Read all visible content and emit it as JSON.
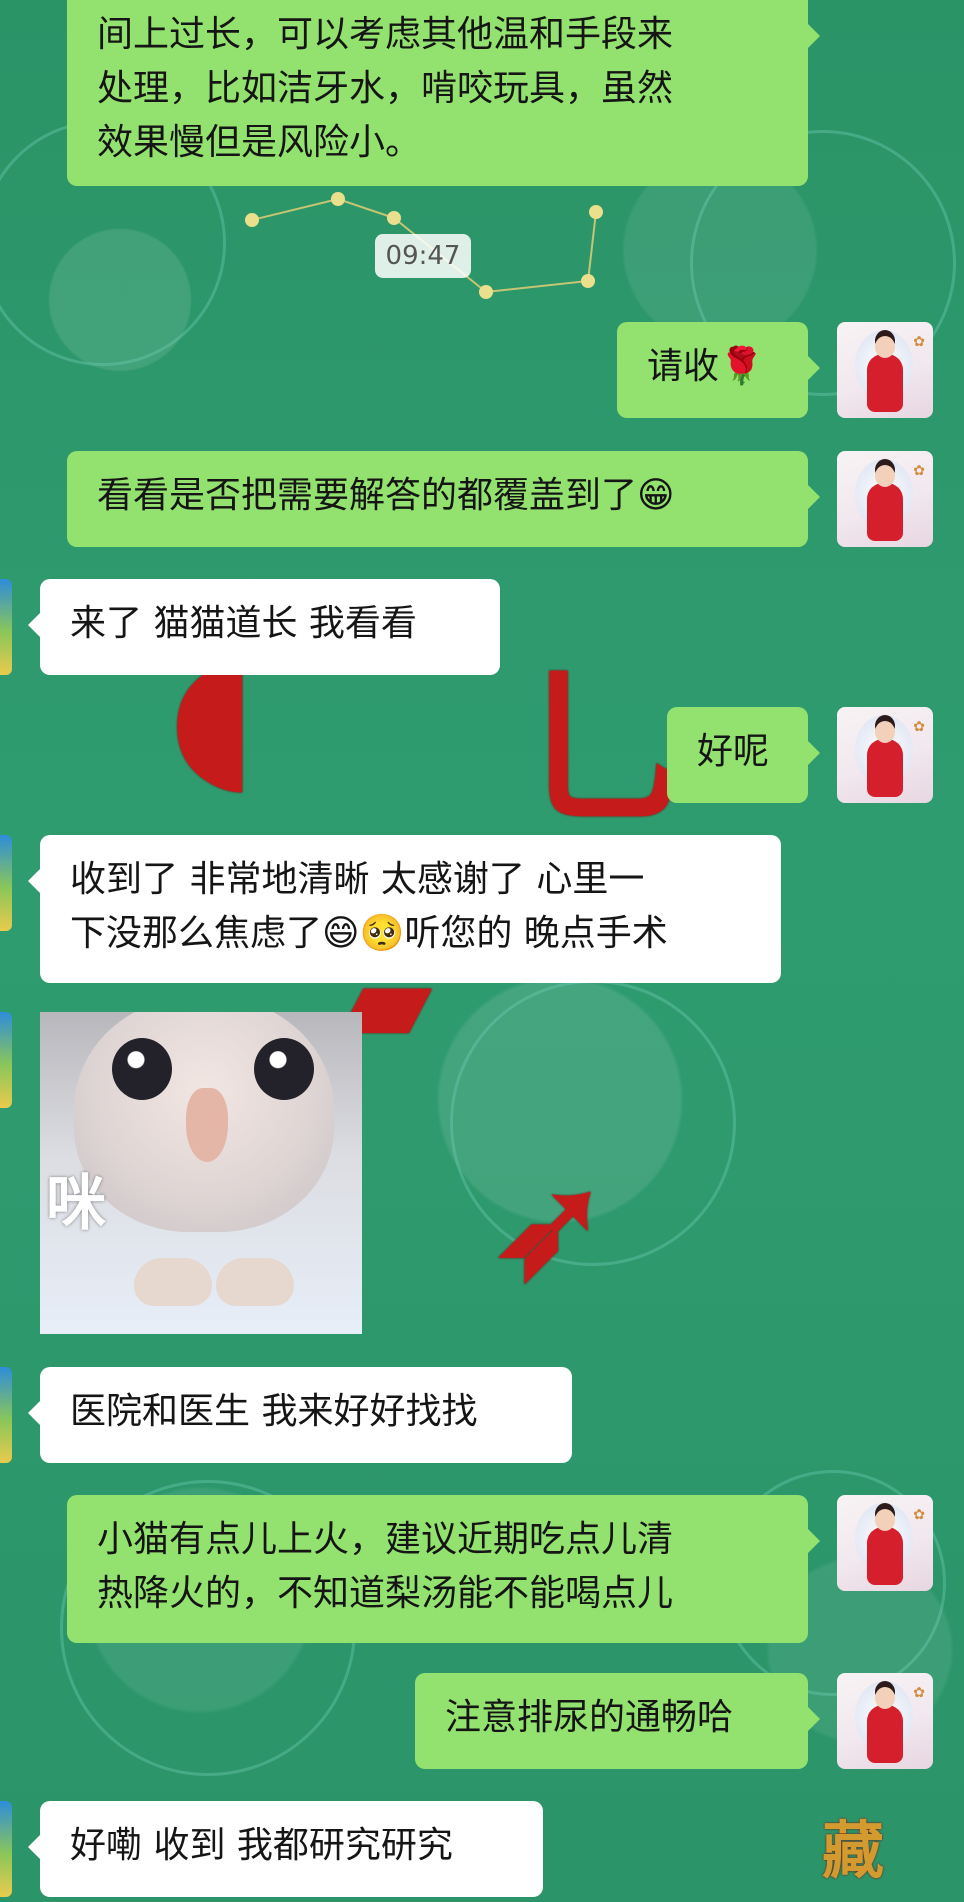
{
  "timestamp": "09:47",
  "messages": {
    "sent_advice_tail": "间上过长，可以考虑其他温和手段来\n处理，比如洁牙水，啃咬玩具，虽然\n效果慢但是风险小。",
    "sent_please_take": "请收🌹",
    "sent_check_coverage": "看看是否把需要解答的都覆盖到了😁",
    "recv_coming": "来了 猫猫道长 我看看",
    "sent_ok": "好呢",
    "recv_received_clear": "收到了  非常地清晰 太感谢了 心里一\n下没那么焦虑了😄🥺听您的 晚点手术",
    "recv_hospital": "医院和医生 我来好好找找",
    "sent_cat_heat": "小猫有点儿上火，建议近期吃点儿清\n热降火的，不知道梨汤能不能喝点儿",
    "sent_urination": "注意排尿的通畅哈",
    "recv_research": "好嘞 收到 我都研究研究"
  },
  "sticker": {
    "caption": "咪"
  },
  "theme": {
    "sent_bubble": "#93e26f",
    "received_bubble": "#ffffff",
    "timestamp_bg": "#ffffff",
    "background": "#2f9a6e"
  },
  "icons": {
    "sender_avatar": "avatar-red-dress-woman-icon",
    "receiver_avatar": "avatar-landscape-icon"
  }
}
